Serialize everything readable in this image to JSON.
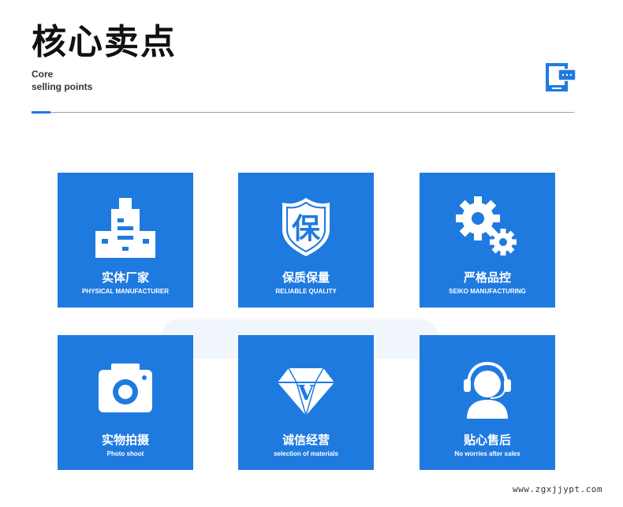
{
  "header": {
    "title": "核心卖点",
    "subtitle_line1": "Core",
    "subtitle_line2": "selling points"
  },
  "colors": {
    "accent": "#1f7ae0",
    "text": "#111111"
  },
  "cards": [
    {
      "icon": "factory-building-icon",
      "title_cn": "实体厂家",
      "title_en": "PHYSICAL MANUFACTURER"
    },
    {
      "icon": "quality-shield-icon",
      "title_cn": "保质保量",
      "title_en": "RELIABLE QUALITY",
      "icon_text": "保"
    },
    {
      "icon": "gears-icon",
      "title_cn": "严格品控",
      "title_en": "SEIKO MANUFACTURING"
    },
    {
      "icon": "camera-icon",
      "title_cn": "实物拍摄",
      "title_en": "Photo shoot"
    },
    {
      "icon": "diamond-icon",
      "title_cn": "诚信经营",
      "title_en": "selection of materials",
      "icon_text": "V"
    },
    {
      "icon": "headset-service-icon",
      "title_cn": "贴心售后",
      "title_en": "No worries after sales"
    }
  ],
  "footer": {
    "watermark": "www.zgxjjypt.com"
  }
}
